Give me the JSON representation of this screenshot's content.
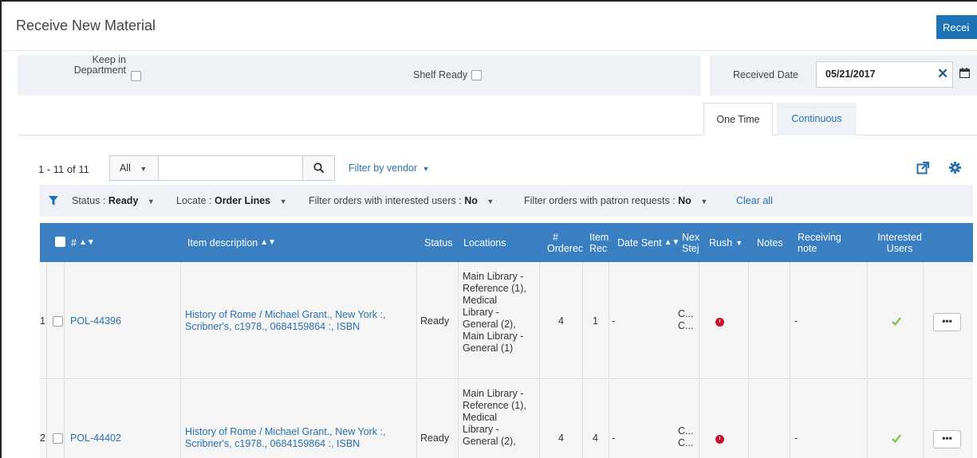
{
  "header": {
    "title": "Receive New Material",
    "receive_button": "Recei"
  },
  "options": {
    "keep_in_department_line1": "Keep in",
    "keep_in_department_line2": "Department",
    "shelf_ready": "Shelf Ready"
  },
  "received_date": {
    "label": "Received Date",
    "value": "05/21/2017",
    "clear_glyph": "✕"
  },
  "tabs": [
    {
      "label": "One Time",
      "active": true
    },
    {
      "label": "Continuous",
      "active": false
    }
  ],
  "toolbar": {
    "count": "1 - 11 of 11",
    "scope": "All",
    "search_value": "",
    "filter_by_vendor": "Filter by vendor"
  },
  "filters": {
    "status": {
      "label": "Status :",
      "value": "Ready"
    },
    "locate": {
      "label": "Locate :",
      "value": "Order Lines"
    },
    "interested": {
      "label": "Filter orders with interested users :",
      "value": "No"
    },
    "patron": {
      "label": "Filter orders with patron requests :",
      "value": "No"
    },
    "clear_all": "Clear all"
  },
  "table": {
    "columns": {
      "num": "#",
      "item_description": "Item description",
      "status": "Status",
      "locations": "Locations",
      "ordered_1": "#",
      "ordered_2": "Orderec",
      "items_1": "Item",
      "items_2": "Rec",
      "date_sent": "Date Sent",
      "next_1": "Nex",
      "next_2": "Stej",
      "rush": "Rush",
      "notes": "Notes",
      "receiving_note_1": "Receiving",
      "receiving_note_2": "note",
      "interested_1": "Interested",
      "interested_2": "Users"
    },
    "rows": [
      {
        "index": "1",
        "pol": "POL-44396",
        "desc_1": "History of Rome / Michael Grant., New York :,",
        "desc_2": "Scribner's, c1978., 0684159864 :, ISBN",
        "status": "Ready",
        "locations": [
          "Main Library -",
          "Reference (1),",
          "Medical",
          "Library -",
          "General (2),",
          "Main Library -",
          "General (1)"
        ],
        "ordered": "4",
        "received": "1",
        "date_sent": "-",
        "next_1": "C...",
        "next_2": "C...",
        "receiving_note": "-"
      },
      {
        "index": "2",
        "pol": "POL-44402",
        "desc_1": "History of Rome / Michael Grant., New York :,",
        "desc_2": "Scribner's, c1978., 0684159864 :, ISBN",
        "status": "Ready",
        "locations": [
          "Main Library -",
          "Reference (1),",
          "Medical",
          "Library -",
          "General (2),"
        ],
        "ordered": "4",
        "received": "4",
        "date_sent": "-",
        "next_1": "C...",
        "next_2": "C...",
        "receiving_note": "-"
      }
    ],
    "more_glyph": "•••"
  },
  "colors": {
    "accent": "#3a7fc1",
    "link": "#2a6fb0",
    "rush": "#c8102e",
    "check": "#8bc34a"
  }
}
